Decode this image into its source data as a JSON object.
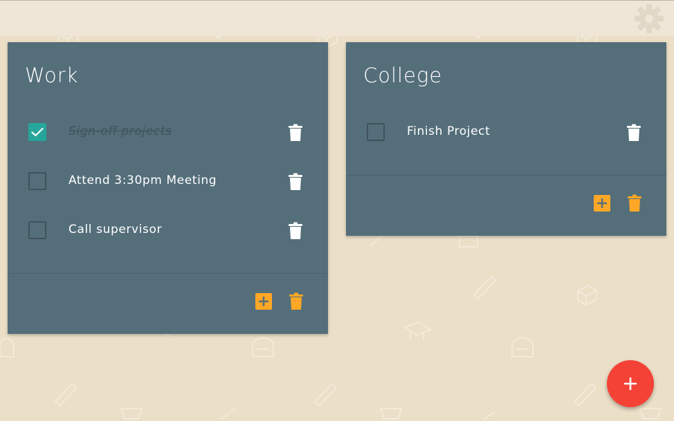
{
  "colors": {
    "background": "#ebdfc7",
    "topbar": "#efe6d7",
    "card": "#546e7a",
    "checkbox_checked": "#26a69a",
    "accent_orange": "#ffa726",
    "fab": "#f44336"
  },
  "topbar": {
    "settings_icon": "gear-icon"
  },
  "lists": [
    {
      "title": "Work",
      "tasks": [
        {
          "text": "Sign-off projects",
          "done": true
        },
        {
          "text": "Attend 3:30pm Meeting",
          "done": false
        },
        {
          "text": "Call supervisor",
          "done": false
        }
      ]
    },
    {
      "title": "College",
      "tasks": [
        {
          "text": "Finish Project",
          "done": false
        }
      ]
    }
  ],
  "fab_icon": "plus-icon"
}
